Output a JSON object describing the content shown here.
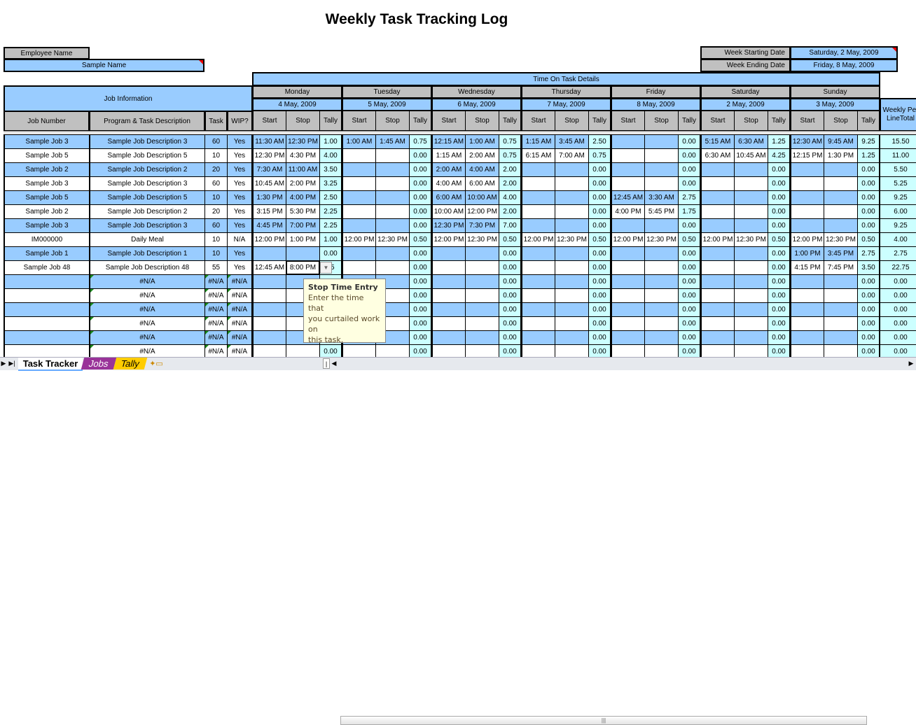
{
  "title": "Weekly Task Tracking Log",
  "employee": {
    "label": "Employee Name",
    "value": "Sample Name"
  },
  "week": {
    "start_label": "Week Starting Date",
    "start_value": "Saturday, 2 May, 2009",
    "end_label": "Week Ending Date",
    "end_value": "Friday, 8 May, 2009"
  },
  "headers": {
    "time_on_task": "Time On Task Details",
    "job_info": "Job Information",
    "job_number": "Job Number",
    "description": "Program  & Task Description",
    "task": "Task",
    "wip": "WIP?",
    "start": "Start",
    "stop": "Stop",
    "tally": "Tally",
    "weekly_total": "Weekly Per LineTotal"
  },
  "days": [
    {
      "name": "Monday",
      "date": "4 May, 2009"
    },
    {
      "name": "Tuesday",
      "date": "5 May, 2009"
    },
    {
      "name": "Wednesday",
      "date": "6 May, 2009"
    },
    {
      "name": "Thursday",
      "date": "7 May, 2009"
    },
    {
      "name": "Friday",
      "date": "8 May, 2009"
    },
    {
      "name": "Saturday",
      "date": "2 May, 2009"
    },
    {
      "name": "Sunday",
      "date": "3 May, 2009"
    }
  ],
  "rows": [
    {
      "job": "Sample Job 3",
      "desc": "Sample Job Description 3",
      "task": "60",
      "wip": "Yes",
      "days": [
        [
          "11:30 AM",
          "12:30 PM",
          "1.00"
        ],
        [
          "1:00 AM",
          "1:45 AM",
          "0.75"
        ],
        [
          "12:15 AM",
          "1:00 AM",
          "0.75"
        ],
        [
          "1:15 AM",
          "3:45 AM",
          "2.50"
        ],
        [
          "",
          "",
          "0.00"
        ],
        [
          "5:15 AM",
          "6:30 AM",
          "1.25"
        ],
        [
          "12:30 AM",
          "9:45 AM",
          "9.25"
        ]
      ],
      "total": "15.50"
    },
    {
      "job": "Sample Job 5",
      "desc": "Sample Job Description 5",
      "task": "10",
      "wip": "Yes",
      "days": [
        [
          "12:30 PM",
          "4:30 PM",
          "4.00"
        ],
        [
          "",
          "",
          "0.00"
        ],
        [
          "1:15 AM",
          "2:00 AM",
          "0.75"
        ],
        [
          "6:15 AM",
          "7:00 AM",
          "0.75"
        ],
        [
          "",
          "",
          "0.00"
        ],
        [
          "6:30 AM",
          "10:45 AM",
          "4.25"
        ],
        [
          "12:15 PM",
          "1:30 PM",
          "1.25"
        ]
      ],
      "total": "11.00"
    },
    {
      "job": "Sample Job 2",
      "desc": "Sample Job Description 2",
      "task": "20",
      "wip": "Yes",
      "days": [
        [
          "7:30 AM",
          "11:00 AM",
          "3.50"
        ],
        [
          "",
          "",
          "0.00"
        ],
        [
          "2:00 AM",
          "4:00 AM",
          "2.00"
        ],
        [
          "",
          "",
          "0.00"
        ],
        [
          "",
          "",
          "0.00"
        ],
        [
          "",
          "",
          "0.00"
        ],
        [
          "",
          "",
          "0.00"
        ]
      ],
      "total": "5.50"
    },
    {
      "job": "Sample Job 3",
      "desc": "Sample Job Description 3",
      "task": "60",
      "wip": "Yes",
      "days": [
        [
          "10:45 AM",
          "2:00 PM",
          "3.25"
        ],
        [
          "",
          "",
          "0.00"
        ],
        [
          "4:00 AM",
          "6:00 AM",
          "2.00"
        ],
        [
          "",
          "",
          "0.00"
        ],
        [
          "",
          "",
          "0.00"
        ],
        [
          "",
          "",
          "0.00"
        ],
        [
          "",
          "",
          "0.00"
        ]
      ],
      "total": "5.25"
    },
    {
      "job": "Sample Job 5",
      "desc": "Sample Job Description 5",
      "task": "10",
      "wip": "Yes",
      "days": [
        [
          "1:30 PM",
          "4:00 PM",
          "2.50"
        ],
        [
          "",
          "",
          "0.00"
        ],
        [
          "6:00 AM",
          "10:00 AM",
          "4.00"
        ],
        [
          "",
          "",
          "0.00"
        ],
        [
          "12:45 AM",
          "3:30 AM",
          "2.75"
        ],
        [
          "",
          "",
          "0.00"
        ],
        [
          "",
          "",
          "0.00"
        ]
      ],
      "total": "9.25"
    },
    {
      "job": "Sample Job 2",
      "desc": "Sample Job Description 2",
      "task": "20",
      "wip": "Yes",
      "days": [
        [
          "3:15 PM",
          "5:30 PM",
          "2.25"
        ],
        [
          "",
          "",
          "0.00"
        ],
        [
          "10:00 AM",
          "12:00 PM",
          "2.00"
        ],
        [
          "",
          "",
          "0.00"
        ],
        [
          "4:00 PM",
          "5:45 PM",
          "1.75"
        ],
        [
          "",
          "",
          "0.00"
        ],
        [
          "",
          "",
          "0.00"
        ]
      ],
      "total": "6.00"
    },
    {
      "job": "Sample Job 3",
      "desc": "Sample Job Description 3",
      "task": "60",
      "wip": "Yes",
      "days": [
        [
          "4:45 PM",
          "7:00 PM",
          "2.25"
        ],
        [
          "",
          "",
          "0.00"
        ],
        [
          "12:30 PM",
          "7:30 PM",
          "7.00"
        ],
        [
          "",
          "",
          "0.00"
        ],
        [
          "",
          "",
          "0.00"
        ],
        [
          "",
          "",
          "0.00"
        ],
        [
          "",
          "",
          "0.00"
        ]
      ],
      "total": "9.25"
    },
    {
      "job": "IM000000",
      "desc": "Daily Meal",
      "task": "10",
      "wip": "N/A",
      "days": [
        [
          "12:00 PM",
          "1:00 PM",
          "1.00"
        ],
        [
          "12:00 PM",
          "12:30 PM",
          "0.50"
        ],
        [
          "12:00 PM",
          "12:30 PM",
          "0.50"
        ],
        [
          "12:00 PM",
          "12:30 PM",
          "0.50"
        ],
        [
          "12:00 PM",
          "12:30 PM",
          "0.50"
        ],
        [
          "12:00 PM",
          "12:30 PM",
          "0.50"
        ],
        [
          "12:00 PM",
          "12:30 PM",
          "0.50"
        ]
      ],
      "total": "4.00"
    },
    {
      "job": "Sample Job 1",
      "desc": "Sample Job Description 1",
      "task": "10",
      "wip": "Yes",
      "days": [
        [
          "",
          "",
          "0.00"
        ],
        [
          "",
          "",
          "0.00"
        ],
        [
          "",
          "",
          "0.00"
        ],
        [
          "",
          "",
          "0.00"
        ],
        [
          "",
          "",
          "0.00"
        ],
        [
          "",
          "",
          "0.00"
        ],
        [
          "1:00 PM",
          "3:45 PM",
          "2.75"
        ]
      ],
      "total": "2.75"
    },
    {
      "job": "Sample Job 48",
      "desc": "Sample Job Description 48",
      "task": "55",
      "wip": "Yes",
      "days": [
        [
          "12:45 AM",
          "8:00 PM",
          "25"
        ],
        [
          "",
          "",
          "0.00"
        ],
        [
          "",
          "",
          "0.00"
        ],
        [
          "",
          "",
          "0.00"
        ],
        [
          "",
          "",
          "0.00"
        ],
        [
          "",
          "",
          "0.00"
        ],
        [
          "4:15 PM",
          "7:45 PM",
          "3.50"
        ]
      ],
      "total": "22.75"
    },
    {
      "job": "",
      "desc": "#N/A",
      "task": "#N/A",
      "wip": "#N/A",
      "na": true,
      "days": [
        [
          "",
          "",
          "0.00"
        ],
        [
          "",
          "",
          "0.00"
        ],
        [
          "",
          "",
          "0.00"
        ],
        [
          "",
          "",
          "0.00"
        ],
        [
          "",
          "",
          "0.00"
        ],
        [
          "",
          "",
          "0.00"
        ],
        [
          "",
          "",
          "0.00"
        ]
      ],
      "total": "0.00"
    },
    {
      "job": "",
      "desc": "#N/A",
      "task": "#N/A",
      "wip": "#N/A",
      "na": true,
      "days": [
        [
          "",
          "",
          "0.00"
        ],
        [
          "",
          "",
          "0.00"
        ],
        [
          "",
          "",
          "0.00"
        ],
        [
          "",
          "",
          "0.00"
        ],
        [
          "",
          "",
          "0.00"
        ],
        [
          "",
          "",
          "0.00"
        ],
        [
          "",
          "",
          "0.00"
        ]
      ],
      "total": "0.00"
    },
    {
      "job": "",
      "desc": "#N/A",
      "task": "#N/A",
      "wip": "#N/A",
      "na": true,
      "days": [
        [
          "",
          "",
          "0.00"
        ],
        [
          "",
          "",
          "0.00"
        ],
        [
          "",
          "",
          "0.00"
        ],
        [
          "",
          "",
          "0.00"
        ],
        [
          "",
          "",
          "0.00"
        ],
        [
          "",
          "",
          "0.00"
        ],
        [
          "",
          "",
          "0.00"
        ]
      ],
      "total": "0.00"
    },
    {
      "job": "",
      "desc": "#N/A",
      "task": "#N/A",
      "wip": "#N/A",
      "na": true,
      "days": [
        [
          "",
          "",
          "0.00"
        ],
        [
          "",
          "",
          "0.00"
        ],
        [
          "",
          "",
          "0.00"
        ],
        [
          "",
          "",
          "0.00"
        ],
        [
          "",
          "",
          "0.00"
        ],
        [
          "",
          "",
          "0.00"
        ],
        [
          "",
          "",
          "0.00"
        ]
      ],
      "total": "0.00"
    },
    {
      "job": "",
      "desc": "#N/A",
      "task": "#N/A",
      "wip": "#N/A",
      "na": true,
      "days": [
        [
          "",
          "",
          "0.00"
        ],
        [
          "",
          "",
          "0.00"
        ],
        [
          "",
          "",
          "0.00"
        ],
        [
          "",
          "",
          "0.00"
        ],
        [
          "",
          "",
          "0.00"
        ],
        [
          "",
          "",
          "0.00"
        ],
        [
          "",
          "",
          "0.00"
        ]
      ],
      "total": "0.00"
    },
    {
      "job": "",
      "desc": "#N/A",
      "task": "#N/A",
      "wip": "#N/A",
      "na": true,
      "days": [
        [
          "",
          "",
          "0.00"
        ],
        [
          "",
          "",
          "0.00"
        ],
        [
          "",
          "",
          "0.00"
        ],
        [
          "",
          "",
          "0.00"
        ],
        [
          "",
          "",
          "0.00"
        ],
        [
          "",
          "",
          "0.00"
        ],
        [
          "",
          "",
          "0.00"
        ]
      ],
      "total": "0.00"
    }
  ],
  "tooltip": {
    "title": "Stop Time Entry",
    "line1": "Enter the time that",
    "line2": "you curtailed work",
    "line3": "on",
    "line4": "this task."
  },
  "sheet_tabs": [
    {
      "label": "Task Tracker",
      "active": true,
      "color": "#ffffff"
    },
    {
      "label": "Jobs",
      "active": false,
      "color": "#993399"
    },
    {
      "label": "Tally",
      "active": false,
      "color": "#ffcc00"
    }
  ],
  "colors": {
    "blue": "#99ccff",
    "gray": "#c0c0c0",
    "tally": "#ccffff"
  },
  "icons": {
    "dropdown": "chevron-down-icon",
    "insert_sheet": "insert-sheet-icon",
    "nav_next": "tab-nav-next-icon",
    "nav_last": "tab-nav-last-icon"
  }
}
